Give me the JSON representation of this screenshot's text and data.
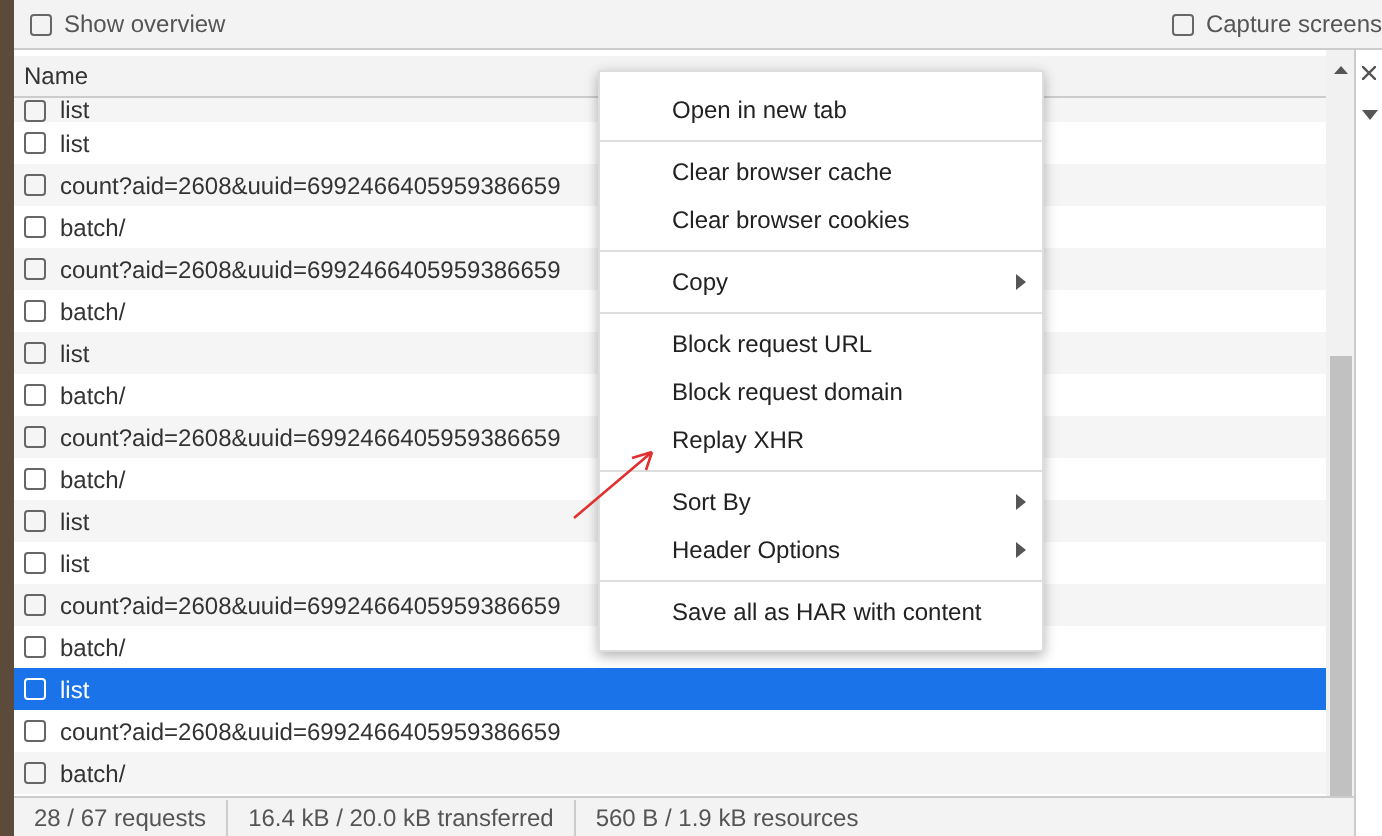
{
  "toolbar": {
    "show_overview": {
      "label": "Show overview",
      "checked": false
    },
    "capture_screenshots": {
      "label": "Capture screens",
      "checked": false
    }
  },
  "table": {
    "columns": [
      "Name"
    ],
    "rows": [
      {
        "name": "list",
        "selected": false,
        "checked": false,
        "partial": true
      },
      {
        "name": "list",
        "selected": false,
        "checked": false
      },
      {
        "name": "count?aid=2608&uuid=6992466405959386659",
        "selected": false,
        "checked": false
      },
      {
        "name": "batch/",
        "selected": false,
        "checked": false
      },
      {
        "name": "count?aid=2608&uuid=6992466405959386659",
        "selected": false,
        "checked": false
      },
      {
        "name": "batch/",
        "selected": false,
        "checked": false
      },
      {
        "name": "list",
        "selected": false,
        "checked": false
      },
      {
        "name": "batch/",
        "selected": false,
        "checked": false
      },
      {
        "name": "count?aid=2608&uuid=6992466405959386659",
        "selected": false,
        "checked": false
      },
      {
        "name": "batch/",
        "selected": false,
        "checked": false
      },
      {
        "name": "list",
        "selected": false,
        "checked": false
      },
      {
        "name": "list",
        "selected": false,
        "checked": false
      },
      {
        "name": "count?aid=2608&uuid=6992466405959386659",
        "selected": false,
        "checked": false
      },
      {
        "name": "batch/",
        "selected": false,
        "checked": false
      },
      {
        "name": "list",
        "selected": true,
        "checked": false
      },
      {
        "name": "count?aid=2608&uuid=6992466405959386659",
        "selected": false,
        "checked": false
      },
      {
        "name": "batch/",
        "selected": false,
        "checked": false
      }
    ]
  },
  "context_menu": {
    "groups": [
      [
        {
          "label": "Open in new tab",
          "submenu": false
        }
      ],
      [
        {
          "label": "Clear browser cache",
          "submenu": false
        },
        {
          "label": "Clear browser cookies",
          "submenu": false
        }
      ],
      [
        {
          "label": "Copy",
          "submenu": true
        }
      ],
      [
        {
          "label": "Block request URL",
          "submenu": false
        },
        {
          "label": "Block request domain",
          "submenu": false
        },
        {
          "label": "Replay XHR",
          "submenu": false
        }
      ],
      [
        {
          "label": "Sort By",
          "submenu": true
        },
        {
          "label": "Header Options",
          "submenu": true
        }
      ],
      [
        {
          "label": "Save all as HAR with content",
          "submenu": false
        }
      ]
    ]
  },
  "status_bar": [
    "28 / 67 requests",
    "16.4 kB / 20.0 kB transferred",
    "560 B / 1.9 kB resources"
  ]
}
